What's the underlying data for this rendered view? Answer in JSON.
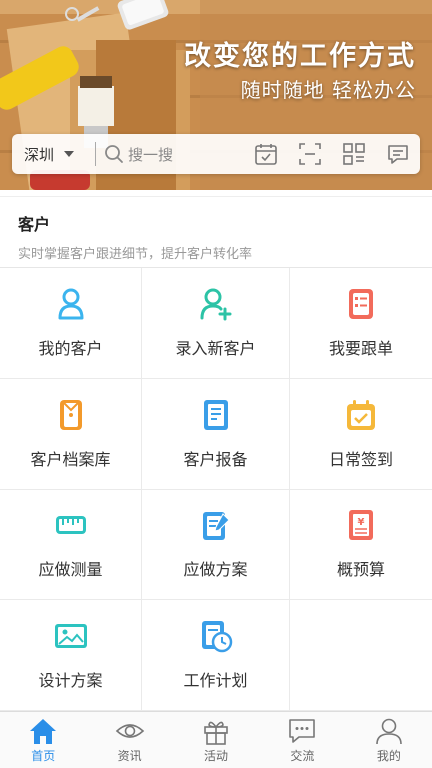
{
  "banner": {
    "headline": "改变您的工作方式",
    "subline": "随时随地 轻松办公"
  },
  "search": {
    "city": "深圳",
    "placeholder": "搜一搜",
    "tools": [
      "calendar-icon",
      "scan-icon",
      "qr-code-icon",
      "message-icon"
    ]
  },
  "section": {
    "title": "客户",
    "subtitle": "实时掌握客户跟进细节，提升客户转化率"
  },
  "grid": {
    "items": [
      {
        "label": "我的客户",
        "icon": "person-icon",
        "color": "#3bb4ee"
      },
      {
        "label": "录入新客户",
        "icon": "add-person-icon",
        "color": "#2cc3a6"
      },
      {
        "label": "我要跟单",
        "icon": "checklist-icon",
        "color": "#f26b5b"
      },
      {
        "label": "客户档案库",
        "icon": "archive-icon",
        "color": "#f39a2b"
      },
      {
        "label": "客户报备",
        "icon": "report-icon",
        "color": "#3a9ee8"
      },
      {
        "label": "日常签到",
        "icon": "calendar-check-icon",
        "color": "#f5b83a"
      },
      {
        "label": "应做测量",
        "icon": "ruler-icon",
        "color": "#2cc3c0"
      },
      {
        "label": "应做方案",
        "icon": "plan-edit-icon",
        "color": "#3a9ee8"
      },
      {
        "label": "概预算",
        "icon": "budget-icon",
        "color": "#f26b5b"
      },
      {
        "label": "设计方案",
        "icon": "image-icon",
        "color": "#2cc3c0"
      },
      {
        "label": "工作计划",
        "icon": "schedule-icon",
        "color": "#3a9ee8"
      }
    ]
  },
  "tabbar": {
    "tabs": [
      {
        "label": "首页",
        "icon": "home-icon",
        "active": true
      },
      {
        "label": "资讯",
        "icon": "eye-icon",
        "active": false
      },
      {
        "label": "活动",
        "icon": "gift-icon",
        "active": false
      },
      {
        "label": "交流",
        "icon": "chat-icon",
        "active": false
      },
      {
        "label": "我的",
        "icon": "user-icon",
        "active": false
      }
    ],
    "active_color": "#2a8ee8"
  }
}
